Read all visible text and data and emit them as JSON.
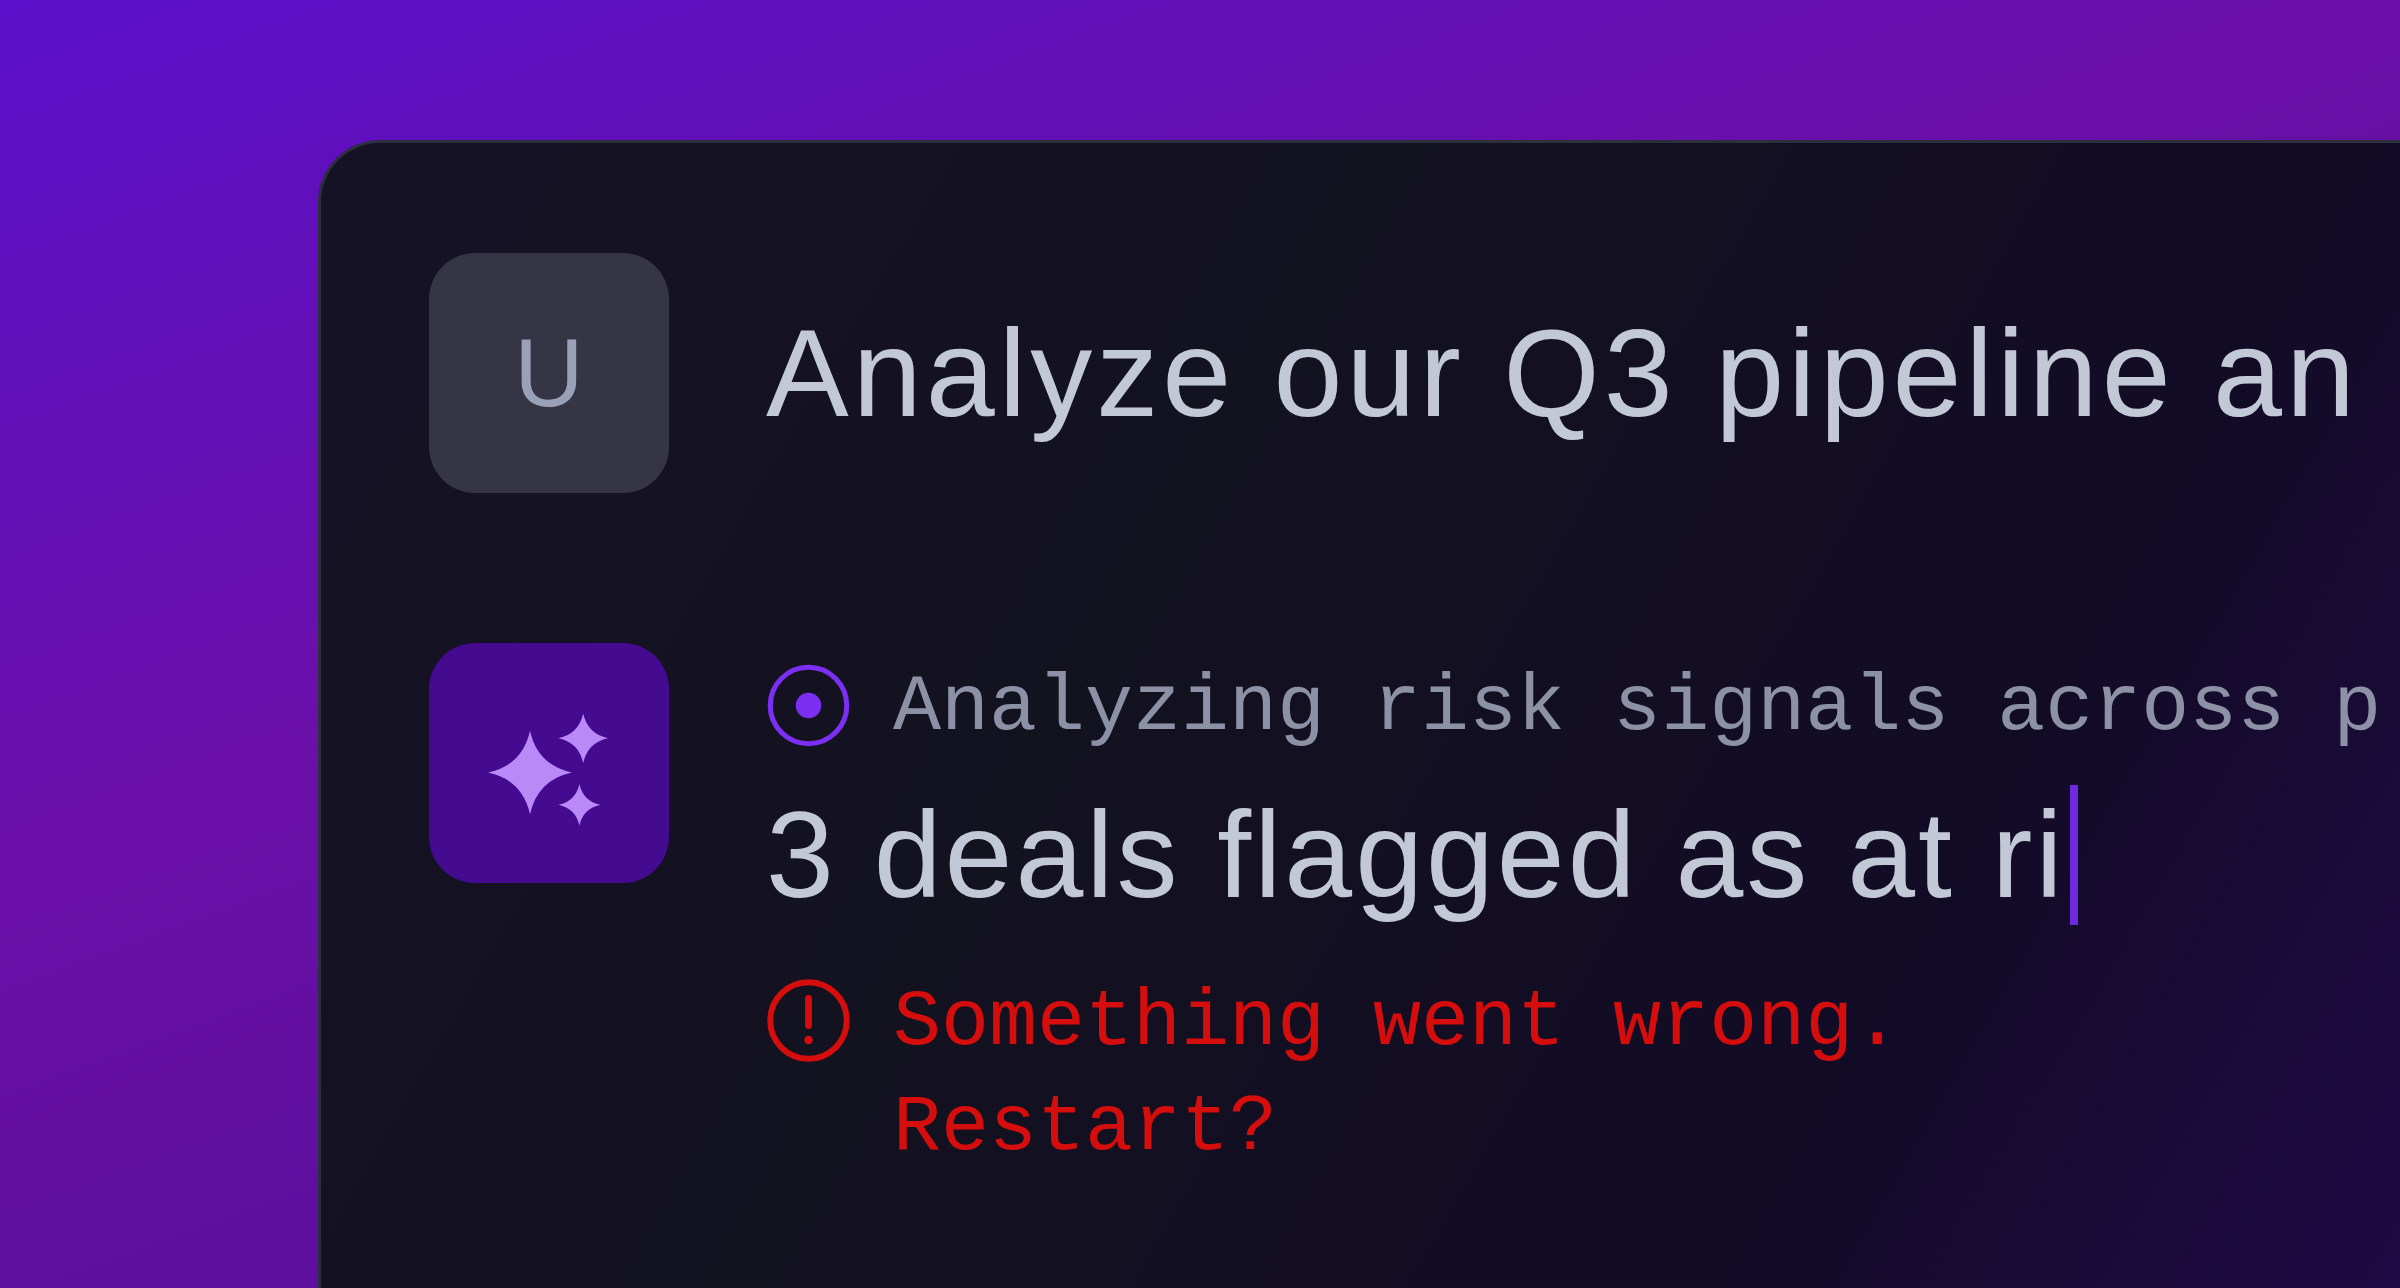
{
  "messages": [
    {
      "kind": "user",
      "avatar": "U",
      "text": "Analyze our Q3 pipeline an"
    },
    {
      "kind": "assistant",
      "status": {
        "kind": "progress",
        "text": "Analyzing risk signals across p"
      },
      "reply": "3 deals flagged as at ri",
      "typing": true,
      "error": {
        "kind": "error",
        "text": "Something went wrong. Restart?"
      }
    }
  ]
}
